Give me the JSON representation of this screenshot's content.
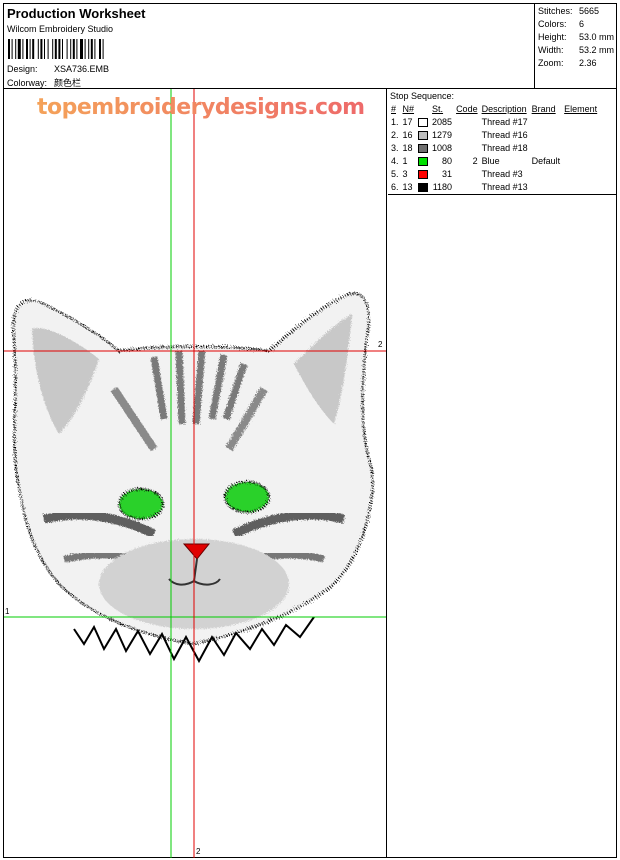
{
  "header": {
    "title": "Production Worksheet",
    "company": "Wilcom  Embroidery Studio",
    "design_label": "Design:",
    "design_value": "XSA736.EMB",
    "colorway_label": "Colorway:",
    "colorway_value": "颜色栏"
  },
  "stats": [
    {
      "label": "Stitches:",
      "value": "5665"
    },
    {
      "label": "Colors:",
      "value": "6"
    },
    {
      "label": "Height:",
      "value": "53.0 mm"
    },
    {
      "label": "Width:",
      "value": "53.2 mm"
    },
    {
      "label": "Zoom:",
      "value": "2.36"
    }
  ],
  "watermark": "topembroiderydesigns.com",
  "axis": {
    "h1_left": "1",
    "h2_right": "2",
    "v2_bottom": "2",
    "v1_left": "1"
  },
  "stop_sequence": {
    "title": "Stop Sequence:",
    "columns": [
      "#",
      "N#",
      "St.",
      "Code",
      "Description",
      "Brand",
      "Element"
    ],
    "rows": [
      {
        "idx": "1.",
        "n": "17",
        "color": "#ffffff",
        "st": "2085",
        "code": "",
        "desc": "Thread #17",
        "brand": "",
        "element": ""
      },
      {
        "idx": "2.",
        "n": "16",
        "color": "#bdbdbd",
        "st": "1279",
        "code": "",
        "desc": "Thread #16",
        "brand": "",
        "element": ""
      },
      {
        "idx": "3.",
        "n": "18",
        "color": "#6e6e6e",
        "st": "1008",
        "code": "",
        "desc": "Thread #18",
        "brand": "",
        "element": ""
      },
      {
        "idx": "4.",
        "n": "1",
        "color": "#00e000",
        "st": "80",
        "code": "2",
        "desc": "Blue",
        "brand": "Default",
        "element": ""
      },
      {
        "idx": "5.",
        "n": "3",
        "color": "#ff0000",
        "st": "31",
        "code": "",
        "desc": "Thread #3",
        "brand": "",
        "element": ""
      },
      {
        "idx": "6.",
        "n": "13",
        "color": "#000000",
        "st": "1180",
        "code": "",
        "desc": "Thread #13",
        "brand": "",
        "element": ""
      }
    ]
  },
  "colors": {
    "guide_red": "#e00000",
    "guide_green": "#00cc00"
  }
}
